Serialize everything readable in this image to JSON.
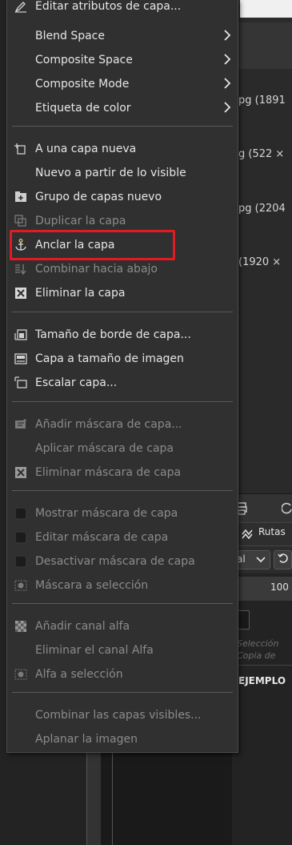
{
  "menu": {
    "items": [
      {
        "label": "Editar atributos de capa...",
        "disabled": false
      },
      {
        "label": "Blend Space",
        "disabled": false
      },
      {
        "label": "Composite Space",
        "disabled": false
      },
      {
        "label": "Composite Mode",
        "disabled": false
      },
      {
        "label": "Etiqueta de color",
        "disabled": false
      },
      {
        "label": "A una capa nueva",
        "disabled": false
      },
      {
        "label": "Nuevo a partir de lo visible",
        "disabled": false
      },
      {
        "label": "Grupo de capas nuevo",
        "disabled": false
      },
      {
        "label": "Duplicar la capa",
        "disabled": true
      },
      {
        "label": "Anclar la capa",
        "disabled": false
      },
      {
        "label": "Combinar hacia abajo",
        "disabled": true
      },
      {
        "label": "Eliminar la capa",
        "disabled": false
      },
      {
        "label": "Tamaño de borde de capa...",
        "disabled": false
      },
      {
        "label": "Capa a tamaño de imagen",
        "disabled": false
      },
      {
        "label": "Escalar capa...",
        "disabled": false
      },
      {
        "label": "Añadir máscara de capa...",
        "disabled": true
      },
      {
        "label": "Aplicar máscara de capa",
        "disabled": true
      },
      {
        "label": "Eliminar máscara de capa",
        "disabled": true
      },
      {
        "label": "Mostrar máscara de capa",
        "disabled": true
      },
      {
        "label": "Editar máscara de capa",
        "disabled": true
      },
      {
        "label": "Desactivar máscara de capa",
        "disabled": true
      },
      {
        "label": "Máscara a selección",
        "disabled": true
      },
      {
        "label": "Añadir canal alfa",
        "disabled": true
      },
      {
        "label": "Eliminar el canal Alfa",
        "disabled": true
      },
      {
        "label": "Alfa a selección",
        "disabled": true
      },
      {
        "label": "Combinar las capas visibles...",
        "disabled": true
      },
      {
        "label": "Aplanar la imagen",
        "disabled": true
      }
    ],
    "highlighted_item": "Anclar la capa",
    "highlight_color": "#e01b24"
  },
  "background": {
    "layers": [
      {
        "text": "pg (1891"
      },
      {
        "text": "g (522 ×"
      },
      {
        "text": "pg (2204"
      },
      {
        "text": "(1920 ×"
      }
    ],
    "tab_label": "Rutas",
    "mode_value": "al",
    "opacity_value": "100",
    "italic_lines": [
      "Selección",
      "Copia de"
    ],
    "layer_name": "EJEMPLO"
  }
}
